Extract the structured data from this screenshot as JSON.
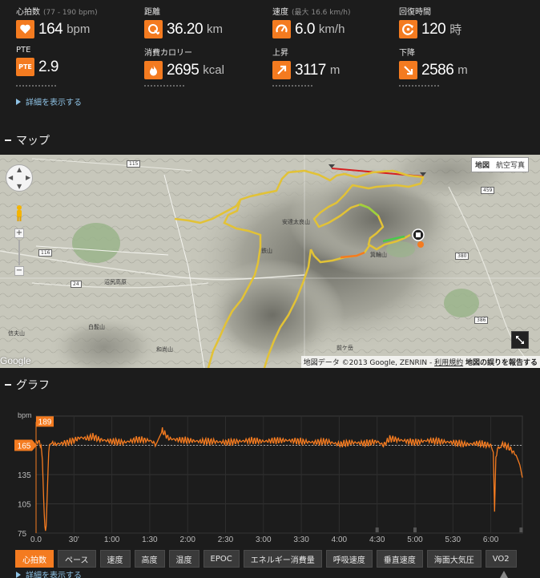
{
  "stats": [
    {
      "label": "心拍数",
      "sub": "(77 - 190 bpm)",
      "value": "164",
      "unit": "bpm",
      "icon": "heart-icon"
    },
    {
      "label": "距離",
      "sub": "",
      "value": "36.20",
      "unit": "km",
      "icon": "distance-icon"
    },
    {
      "label": "速度",
      "sub": "(最大 16.6 km/h)",
      "value": "6.0",
      "unit": "km/h",
      "icon": "speedometer-icon"
    },
    {
      "label": "回復時間",
      "sub": "",
      "value": "120",
      "unit": "時",
      "icon": "recovery-icon"
    },
    {
      "label": "PTE",
      "sub": "",
      "value": "2.9",
      "unit": "",
      "icon": "pte-icon",
      "icon_text": "PTE"
    },
    {
      "label": "消費カロリー",
      "sub": "",
      "value": "2695",
      "unit": "kcal",
      "icon": "flame-icon"
    },
    {
      "label": "上昇",
      "sub": "",
      "value": "3117",
      "unit": "m",
      "icon": "ascent-icon"
    },
    {
      "label": "下降",
      "sub": "",
      "value": "2586",
      "unit": "m",
      "icon": "descent-icon"
    }
  ],
  "details_link": "詳細を表示する",
  "map_section": {
    "title": "マップ",
    "map_type": {
      "map": "地図",
      "satellite": "航空写真"
    },
    "google": "Google",
    "attribution": {
      "data": "地図データ ©2013 Google, ZENRIN",
      "terms": "利用規約",
      "report": "地図の誤りを報告する"
    },
    "labels": [
      "安達太良山",
      "鉄山",
      "箕輪山",
      "沼尻高原",
      "白髭山",
      "前ケ岳",
      "和尚山",
      "信夫山"
    ],
    "roads": [
      "115",
      "116",
      "24",
      "459",
      "380",
      "386"
    ]
  },
  "graph_section": {
    "title": "グラフ",
    "y_unit": "bpm",
    "max_label": "189",
    "avg_label": "165",
    "tabs": [
      "心拍数",
      "ペース",
      "速度",
      "高度",
      "温度",
      "EPOC",
      "エネルギー消費量",
      "呼吸速度",
      "垂直速度",
      "海面大気圧",
      "VO2"
    ],
    "active_tab": "心拍数",
    "details_link": "詳細を表示する"
  },
  "chart_data": {
    "type": "line",
    "title": "",
    "xlabel": "",
    "ylabel": "bpm",
    "x_ticks": [
      "0.0",
      "30'",
      "1:00",
      "1:30",
      "2:00",
      "2:30",
      "3:00",
      "3:30",
      "4:00",
      "4:30",
      "5:00",
      "5:30",
      "6:00"
    ],
    "y_ticks": [
      75,
      105,
      135,
      165
    ],
    "ylim": [
      75,
      195
    ],
    "xlim_minutes": [
      0,
      385
    ],
    "max_bpm": 189,
    "avg_bpm": 165,
    "color": "#f47b20",
    "series": [
      {
        "x_minutes": [
          0,
          2,
          4,
          5,
          6,
          7,
          8,
          9,
          10,
          12,
          15,
          20,
          25,
          30,
          35,
          40,
          45,
          50,
          55,
          60,
          70,
          80,
          90,
          95,
          100,
          105,
          110,
          120,
          130,
          140,
          150,
          160,
          170,
          180,
          190,
          200,
          210,
          220,
          230,
          240,
          250,
          260,
          270,
          275,
          280,
          290,
          300,
          310,
          320,
          330,
          340,
          350,
          360,
          362,
          363,
          364,
          366,
          370,
          375,
          380,
          383,
          385
        ],
        "y": [
          170,
          168,
          165,
          150,
          110,
          80,
          82,
          120,
          160,
          168,
          166,
          167,
          168,
          170,
          173,
          172,
          174,
          171,
          170,
          169,
          168,
          171,
          170,
          166,
          180,
          172,
          171,
          170,
          169,
          169,
          168,
          169,
          170,
          169,
          170,
          170,
          169,
          168,
          169,
          166,
          168,
          167,
          169,
          165,
          172,
          170,
          168,
          170,
          169,
          168,
          166,
          167,
          165,
          158,
          97,
          155,
          162,
          166,
          162,
          155,
          145,
          132
        ]
      }
    ]
  }
}
